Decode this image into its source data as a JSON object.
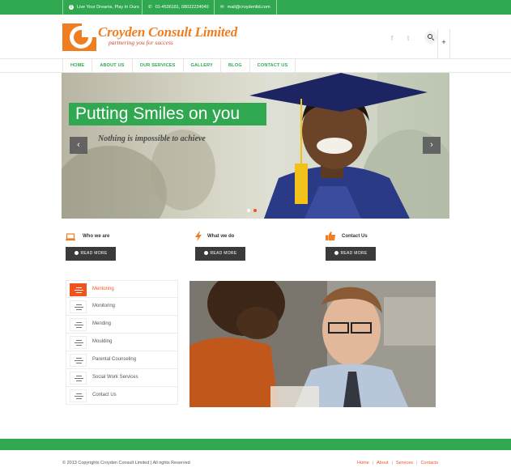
{
  "topbar": {
    "tagline": "Live Your Dreams, Play In Ours",
    "phone": "01-4536181, 08022234040",
    "email": "mail@croydenltd.com"
  },
  "header": {
    "logo_text": "Croyden Consult Limited",
    "logo_tagline": "partnering you for success",
    "social": [
      "f",
      "t"
    ],
    "plus_label": "+"
  },
  "nav": [
    "HOME",
    "ABOUT US",
    "OUR SERVICES",
    "GALLERY",
    "BLOG",
    "CONTACT US"
  ],
  "hero": {
    "title": "Putting Smiles on you",
    "subtitle": "Nothing is impossible to achieve",
    "prev": "‹",
    "next": "›"
  },
  "features": [
    {
      "title": "Who we are",
      "button": "READ MORE",
      "icon": "laptop-icon"
    },
    {
      "title": "What we do",
      "button": "READ MORE",
      "icon": "bolt-icon"
    },
    {
      "title": "Contact Us",
      "button": "READ MORE",
      "icon": "thumbs-up-icon"
    }
  ],
  "services": [
    "Mentoring",
    "Monitoring",
    "Mending",
    "Moulding",
    "Parental Counseling",
    "Social Work Services",
    "Contact Us"
  ],
  "footer": {
    "copyright": "© 2013 Copyrights Croyden Consult Limited | All rights Reserved",
    "links": [
      "Home",
      "About",
      "Services",
      "Contacts"
    ],
    "separator": "|"
  },
  "colors": {
    "brand_green": "#2fa84f",
    "brand_orange": "#f07d1f",
    "accent_red": "#f0541e"
  }
}
